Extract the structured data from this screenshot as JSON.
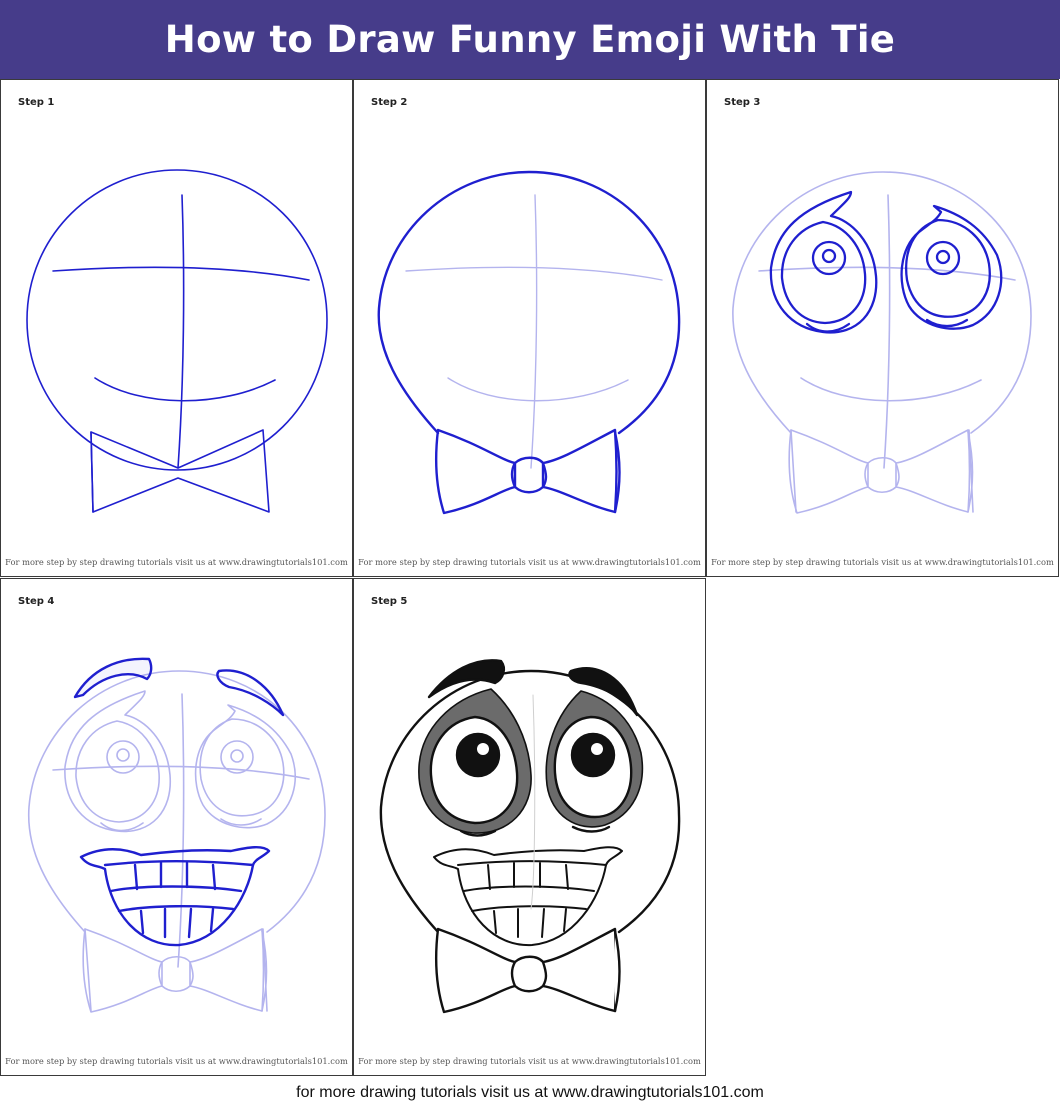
{
  "header": {
    "title": "How to Draw Funny Emoji With Tie"
  },
  "steps": [
    {
      "label": "Step 1",
      "credit": "For more step by step drawing tutorials visit us at www.drawingtutorials101.com"
    },
    {
      "label": "Step 2",
      "credit": "For more step by step drawing tutorials visit us at www.drawingtutorials101.com"
    },
    {
      "label": "Step 3",
      "credit": "For more step by step drawing tutorials visit us at www.drawingtutorials101.com"
    },
    {
      "label": "Step 4",
      "credit": "For more step by step drawing tutorials visit us at www.drawingtutorials101.com"
    },
    {
      "label": "Step 5",
      "credit": "For more step by step drawing tutorials visit us at www.drawingtutorials101.com"
    }
  ],
  "footer": {
    "text": "for more drawing tutorials visit us at www.drawingtutorials101.com"
  },
  "colors": {
    "header_bg": "#463c8a",
    "stroke_active": "#1f1fcf",
    "stroke_guide": "#b4b4ee",
    "stroke_final": "#111111",
    "eye_shadow": "#6b6b6b"
  }
}
